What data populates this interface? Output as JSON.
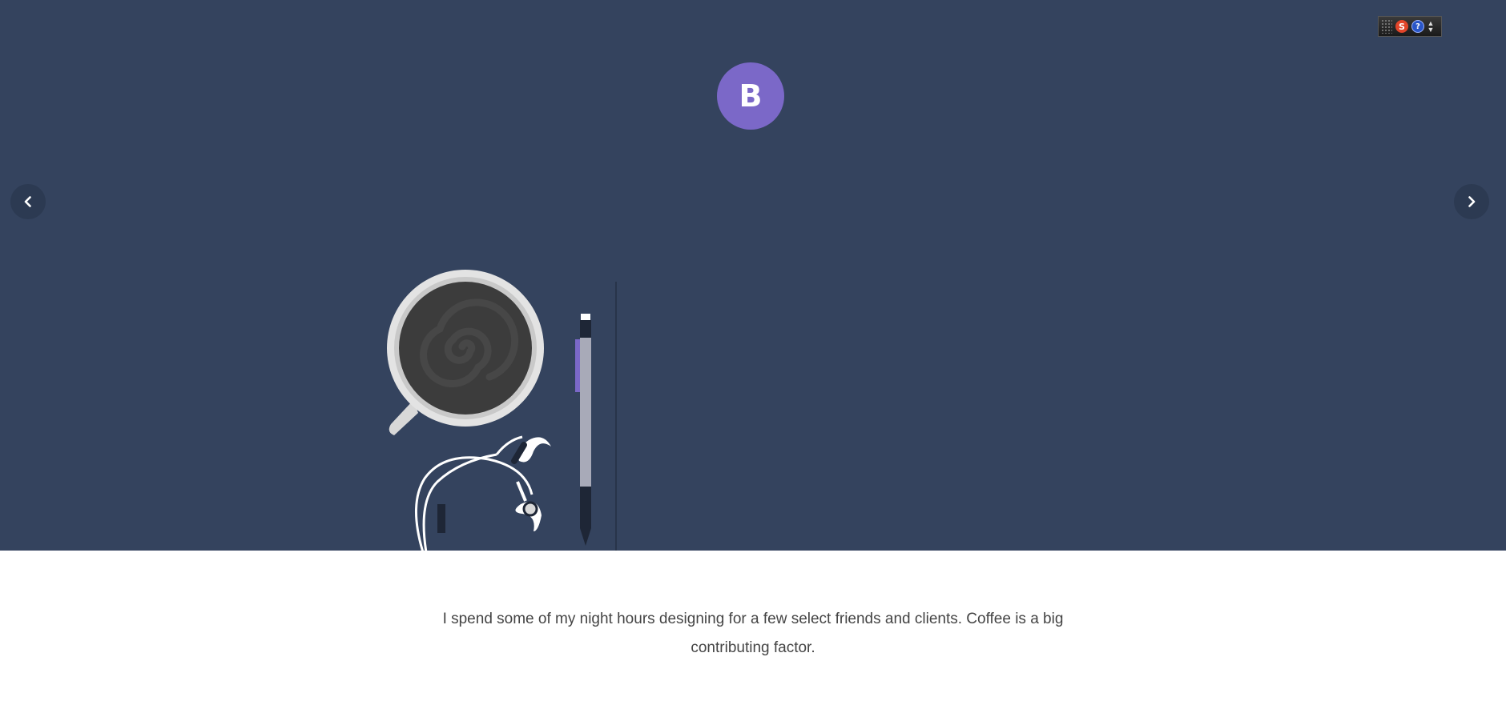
{
  "logo": {
    "letter": "B",
    "color": "#7b68c8"
  },
  "hero": {
    "background": "#34435e"
  },
  "toolbar": {
    "s_label": "S",
    "help_label": "?",
    "icons": [
      "grip-icon",
      "s-logo-icon",
      "help-icon",
      "toolbar-menu-arrow-icon"
    ]
  },
  "navigation": {
    "prev_icon": "chevron-left-icon",
    "next_icon": "chevron-right-icon"
  },
  "illustration": {
    "items": [
      "coffee-cup-icon",
      "pencil-icon",
      "earphones-icon",
      "notebook-edge"
    ]
  },
  "caption": {
    "text": "I spend some of my night hours designing for a few select friends and clients. Coffee is a big contributing factor."
  }
}
